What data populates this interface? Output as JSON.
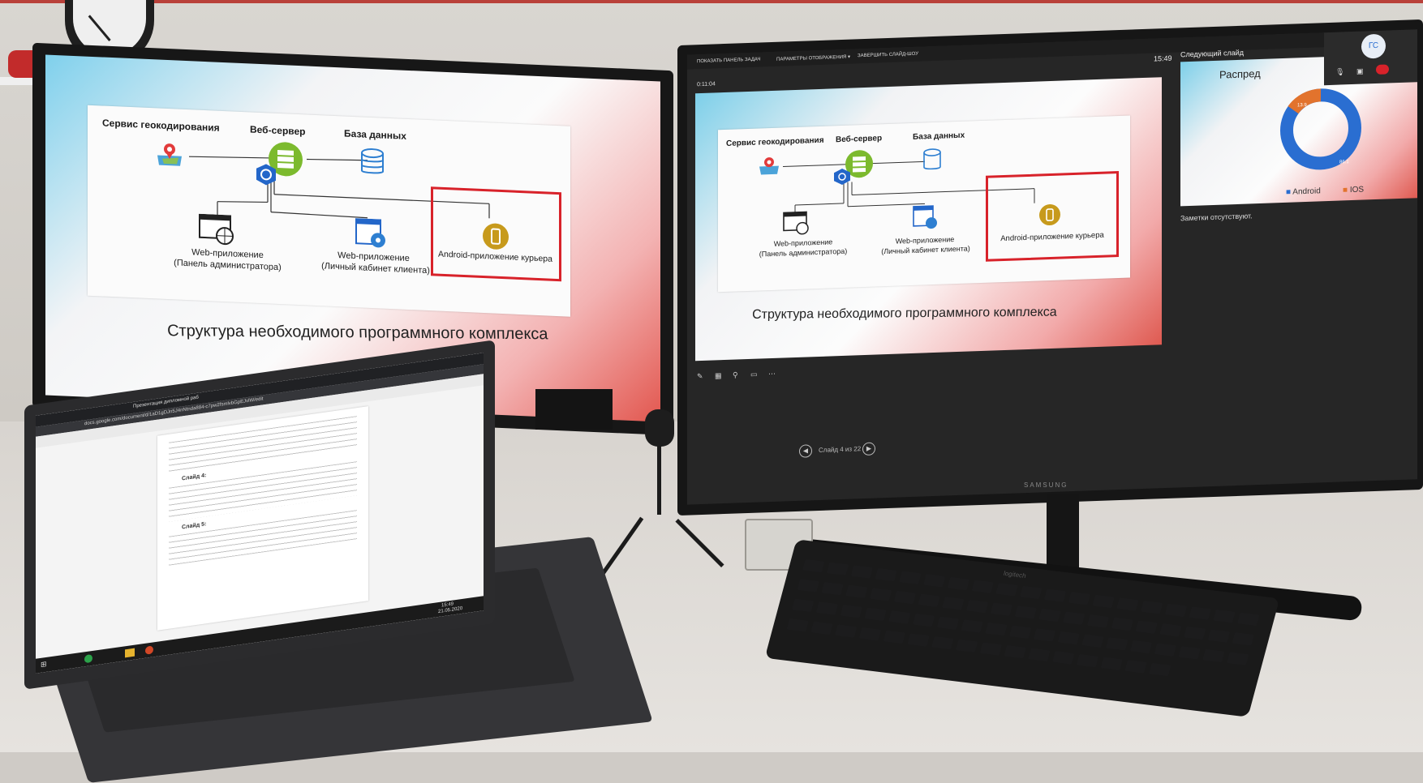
{
  "left_slide": {
    "labels": {
      "geocoding": "Сервис геокодирования",
      "webserver": "Веб-сервер",
      "database": "База данных"
    },
    "captions": {
      "admin_line1": "Web-приложение",
      "admin_line2": "(Панель администратора)",
      "client_line1": "Web-приложение",
      "client_line2": "(Личный кабинет клиента)",
      "android": "Android-приложение курьера"
    },
    "title": "Структура необходимого программного комплекса"
  },
  "presenter": {
    "toolbar": {
      "show_taskbar": "ПОКАЗАТЬ ПАНЕЛЬ ЗАДАЧ",
      "display_settings": "ПАРАМЕТРЫ ОТОБРАЖЕНИЯ ▾",
      "end_show": "ЗАВЕРШИТЬ СЛАЙД-ШОУ"
    },
    "timer": "0:11:04",
    "clock": "15:49",
    "next_slide_label": "Следующий слайд",
    "next_slide_title": "Распред",
    "next_slide_values": {
      "android": "86.1",
      "ios": "13.9"
    },
    "legend": {
      "android": "Android",
      "ios": "IOS"
    },
    "notes": "Заметки отсутствуют.",
    "slide_counter": "Слайд 4 из 22",
    "participant_initials": "ГС",
    "brand": "SAMSUNG"
  },
  "laptop": {
    "tab_title": "Презентация дипломной раб",
    "url": "docs.google.com/document/d/1aD1gDJn5J4nNtnda884-c7pw2fsmlvbGpEJvlW/edit",
    "doc_headings": [
      "Слайд 4:",
      "Слайд 5:"
    ],
    "time": "15:49",
    "date": "21.05.2020"
  },
  "keyboard_brand": "logitech",
  "colors": {
    "accent_red": "#d8222a",
    "accent_green": "#7cba2e",
    "accent_blue": "#2366c9",
    "android_orange": "#c79a1c",
    "chart_blue": "#2a6ed1",
    "chart_orange": "#e2732d"
  }
}
